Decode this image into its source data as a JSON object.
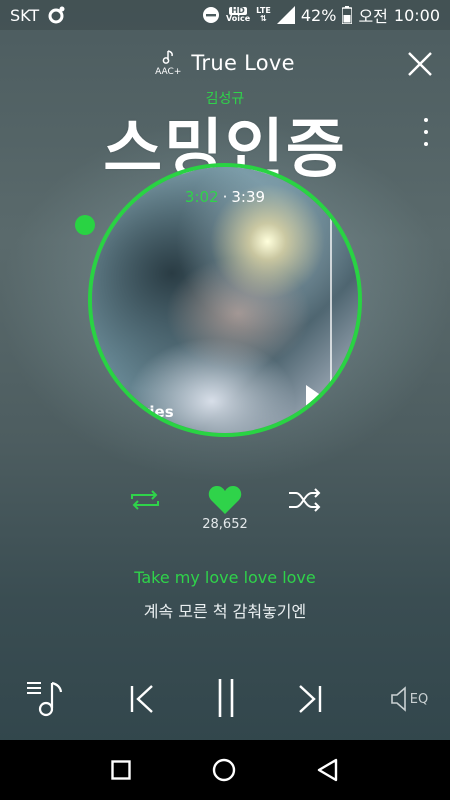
{
  "status": {
    "carrier": "SKT",
    "hd_label": "HD",
    "voice_label": "Voice",
    "lte_label": "LTE",
    "battery_percent": "42%",
    "ampm": "오전",
    "time": "10:00"
  },
  "header": {
    "codec_label": "AAC+",
    "title": "True Love"
  },
  "artist": "김성규",
  "overlay_text": "스밍인증",
  "playback": {
    "current_time": "3:02",
    "separator": "·",
    "total_time": "3:39"
  },
  "album": {
    "cover_text": "ries"
  },
  "likes_count": "28,652",
  "lyrics": {
    "current": "Take my love love love",
    "next": "계속 모른 척 감춰놓기엔"
  },
  "bottom_controls": {
    "eq_label": "EQ"
  },
  "colors": {
    "accent": "#29d343",
    "navbar": "#000000"
  },
  "icons": [
    "music-note-icon",
    "lte-icon",
    "signal-icon",
    "battery-icon",
    "close-icon",
    "more-icon",
    "repeat-icon",
    "heart-icon",
    "shuffle-icon",
    "playlist-icon",
    "previous-icon",
    "pause-icon",
    "next-icon",
    "eq-speaker-icon",
    "recent-apps-icon",
    "home-icon",
    "back-icon"
  ]
}
